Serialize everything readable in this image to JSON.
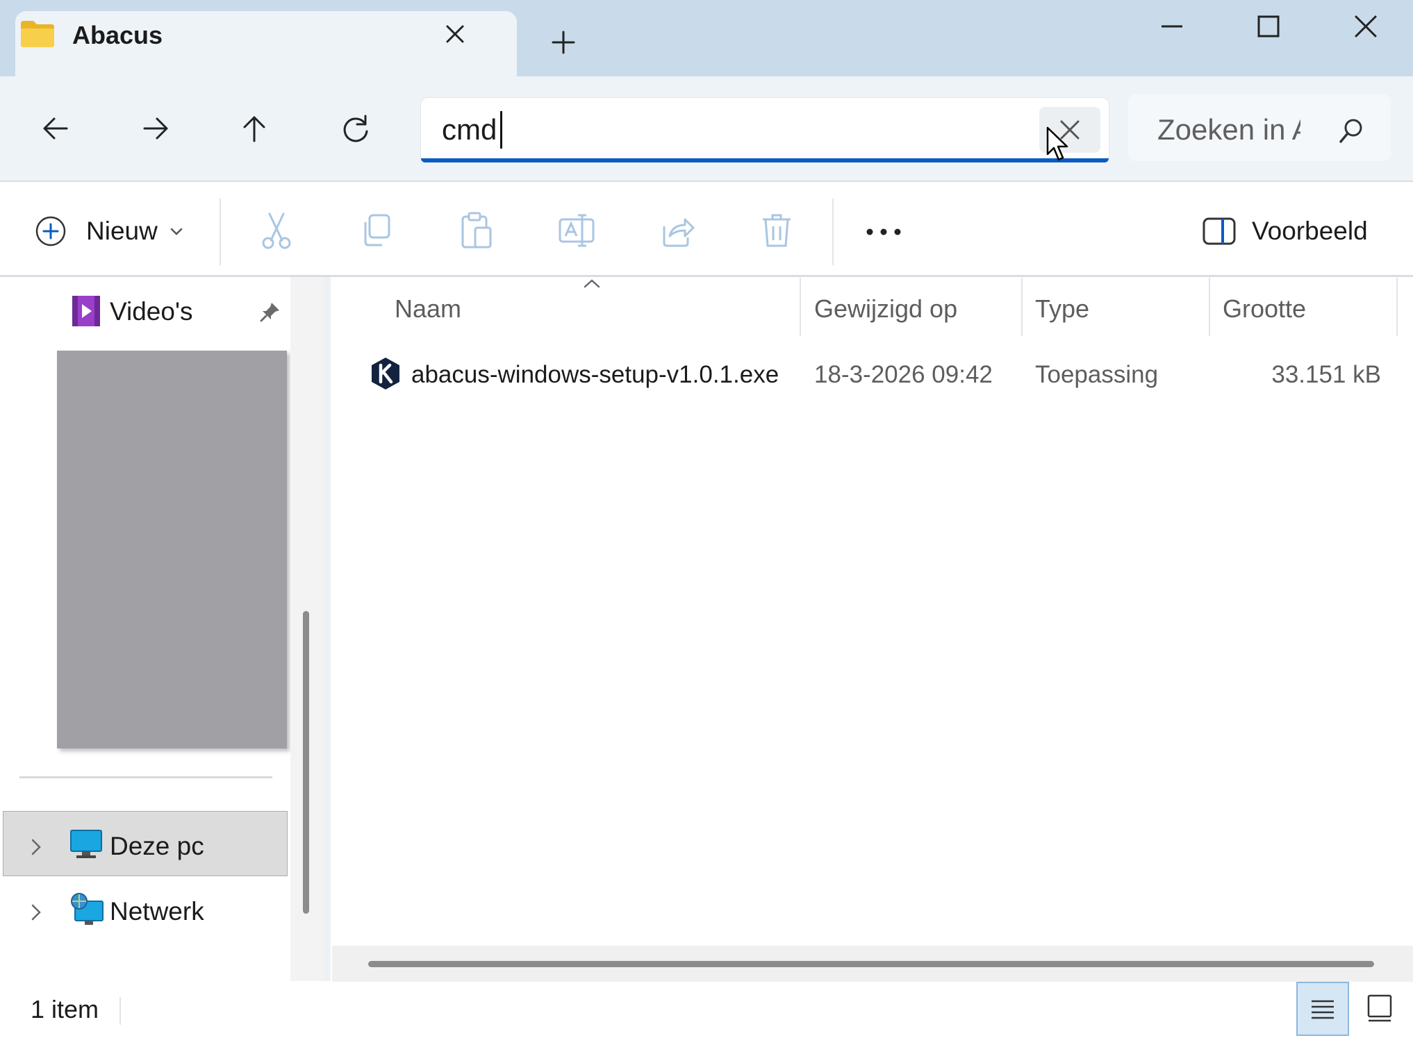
{
  "tab": {
    "title": "Abacus",
    "close_icon": "close-icon",
    "new_tab_icon": "plus-icon"
  },
  "window_controls": [
    "minimize-icon",
    "maximize-icon",
    "close-icon"
  ],
  "navigation": [
    "back-arrow-icon",
    "forward-arrow-icon",
    "up-arrow-icon",
    "refresh-icon"
  ],
  "address_bar": {
    "value": "cmd",
    "clear_icon": "close-icon"
  },
  "search": {
    "placeholder": "Zoeken in Abacus",
    "icon": "search-icon"
  },
  "command_bar": {
    "new_label": "Nieuw",
    "actions": [
      "cut-icon",
      "copy-icon",
      "paste-icon",
      "rename-icon",
      "share-icon",
      "delete-icon"
    ],
    "more_icon": "more-dots-icon",
    "preview_label": "Voorbeeld"
  },
  "nav_pane": {
    "pinned": {
      "label": "Video's",
      "icon": "videos-folder-icon"
    },
    "items": [
      {
        "label": "Deze pc",
        "icon": "computer-icon",
        "selected": true
      },
      {
        "label": "Netwerk",
        "icon": "network-icon",
        "selected": false
      }
    ]
  },
  "file_list": {
    "columns": [
      "Naam",
      "Gewijzigd op",
      "Type",
      "Grootte"
    ],
    "rows": [
      {
        "name": "abacus-windows-setup-v1.0.1.exe",
        "modified": "18-3-2026 09:42",
        "type": "Toepassing",
        "size": "33.151 kB"
      }
    ]
  },
  "status_bar": {
    "count": "1 item"
  },
  "colors": {
    "accent": "#0b5cc2",
    "titlebar": "#c9dbea",
    "toolbar": "#eef3f8"
  }
}
